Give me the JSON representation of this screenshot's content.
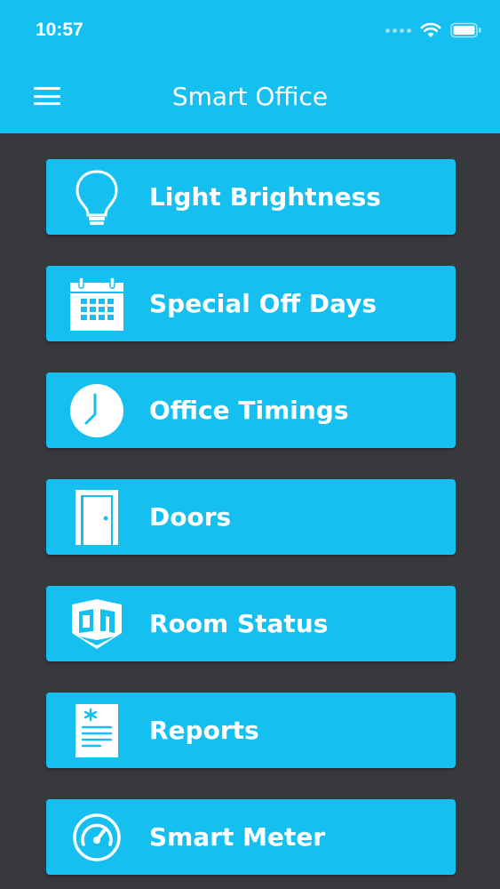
{
  "status_bar": {
    "time": "10:57"
  },
  "header": {
    "title": "Smart Office",
    "menu_icon": "hamburger-menu-icon"
  },
  "colors": {
    "accent": "#15c0f1",
    "background": "#38393d",
    "text": "#ffffff"
  },
  "menu": {
    "items": [
      {
        "label": "Light Brightness",
        "icon": "lightbulb-icon"
      },
      {
        "label": "Special Off Days",
        "icon": "calendar-icon"
      },
      {
        "label": "Office Timings",
        "icon": "clock-icon"
      },
      {
        "label": "Doors",
        "icon": "door-icon"
      },
      {
        "label": "Room Status",
        "icon": "room-status-icon"
      },
      {
        "label": "Reports",
        "icon": "report-icon"
      },
      {
        "label": "Smart Meter",
        "icon": "meter-icon"
      }
    ]
  }
}
